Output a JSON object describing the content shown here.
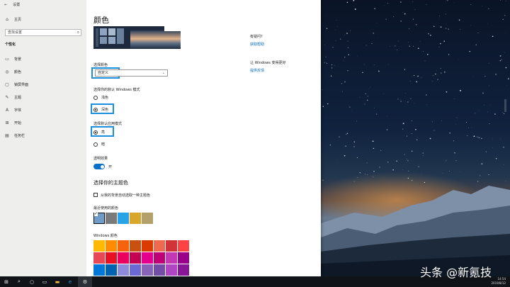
{
  "window": {
    "title": "设置"
  },
  "nav": {
    "home_label": "主页",
    "search_placeholder": "查找设置",
    "section_title": "个性化",
    "items": [
      {
        "label": "背景",
        "icon": "picture-icon"
      },
      {
        "label": "颜色",
        "icon": "palette-icon"
      },
      {
        "label": "锁屏界面",
        "icon": "lock-screen-icon"
      },
      {
        "label": "主题",
        "icon": "brush-icon"
      },
      {
        "label": "字体",
        "icon": "font-icon"
      },
      {
        "label": "开始",
        "icon": "start-icon"
      },
      {
        "label": "任务栏",
        "icon": "taskbar-icon"
      }
    ]
  },
  "main": {
    "title": "颜色",
    "choose_color_label": "选择颜色",
    "choose_color_value": "自定义",
    "windows_mode_label": "选择你的默认 Windows 模式",
    "windows_mode_options": [
      "浅色",
      "深色"
    ],
    "windows_mode_selected": "深色",
    "app_mode_label": "选择默认应用模式",
    "app_mode_options": [
      "亮",
      "暗"
    ],
    "app_mode_selected": "亮",
    "transparency_label": "透明效果",
    "transparency_state": "开",
    "transparency_on": true,
    "accent_title": "选择你的主题色",
    "auto_accent_label": "从我的背景自动选取一种主题色",
    "auto_accent_checked": false,
    "recent_colors_label": "最近使用的颜色",
    "recent_colors": [
      "#6e9cc8",
      "#7a7a7a",
      "#2aa3e6",
      "#d8a72a",
      "#b4a06a"
    ],
    "windows_colors_label": "Windows 颜色",
    "windows_colors": [
      [
        "#ffb900",
        "#ff8c00",
        "#f7630c",
        "#ca5010",
        "#da3b01",
        "#ef6950",
        "#d13438",
        "#ff4343"
      ],
      [
        "#e74856",
        "#e81123",
        "#ea005e",
        "#c30052",
        "#e3008c",
        "#bf0077",
        "#c239b3",
        "#9a0089"
      ],
      [
        "#0078d7",
        "#0063b1",
        "#8e8cd8",
        "#6b69d6",
        "#8764b8",
        "#744da9",
        "#b146c2",
        "#881798"
      ]
    ]
  },
  "right_panel": {
    "help_title": "有疑问?",
    "help_link": "获取帮助",
    "improve_title": "让 Windows 变得更好",
    "improve_link": "提供反馈"
  },
  "taskbar": {
    "time": "14:54",
    "date": "2019/8/12"
  },
  "watermark": "头条 @新氪技",
  "colors": {
    "accent": "#1a8fe0",
    "link": "#0067b8",
    "toggle_on": "#0a6fc6",
    "nav_bg": "#eeeeec",
    "taskbar_bg": "#101418"
  }
}
